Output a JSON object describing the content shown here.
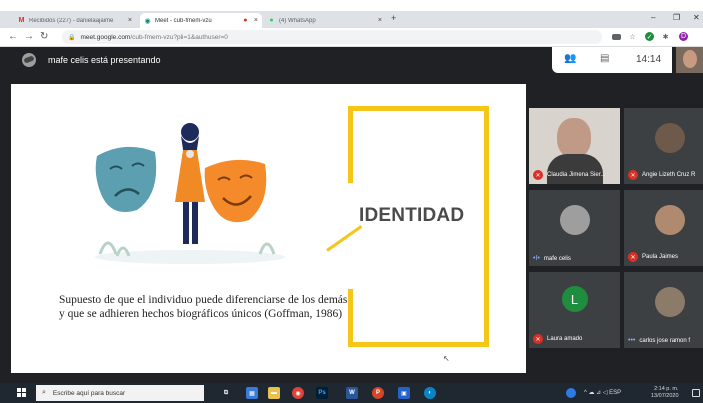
{
  "browser": {
    "tabs": [
      {
        "label": "Recibidos (227) - danielaajaime",
        "close": "×",
        "active": false
      },
      {
        "label": "Meet - cub-fmem-vzu",
        "close": "×",
        "active": true
      },
      {
        "label": "(4) WhatsApp",
        "close": "×",
        "active": false
      }
    ],
    "new_tab": "+",
    "minimize": "–",
    "restore": "❐",
    "close": "✕",
    "url_host": "meet.google.com",
    "url_path": "/cub-fmem-vzu?pli=1&authuser=0",
    "profile_initial": "D"
  },
  "meet": {
    "presenting_text": "mafe celis está presentando",
    "clock": "14:14",
    "participants": [
      {
        "name": "Claudia Jimena Sier...",
        "muted": true
      },
      {
        "name": "Angie Lizeth Cruz R",
        "muted": true
      },
      {
        "name": "mafe celis",
        "muted": false
      },
      {
        "name": "Paula Jaimes",
        "muted": true
      },
      {
        "name": "Laura amado",
        "muted": true,
        "avatar_letter": "L"
      },
      {
        "name": "carlos jose ramon f",
        "muted": false
      }
    ]
  },
  "slide": {
    "title": "IDENTIDAD",
    "caption": "Supuesto de que el individuo puede diferenciarse de los demás y que se adhieren hechos biográficos únicos (Goffman, 1986)"
  },
  "taskbar": {
    "search_placeholder": "Escribe aquí para buscar",
    "tray": "^ ☁ ⊿ ◁ ESP",
    "time": "2:14 p. m.",
    "date": "13/07/2020"
  },
  "colors": {
    "frame_yellow": "#f5c518",
    "mask_teal": "#5b9fb0",
    "mask_orange": "#f58a2a",
    "muted_red": "#d93025",
    "meet_bg": "#202124"
  }
}
